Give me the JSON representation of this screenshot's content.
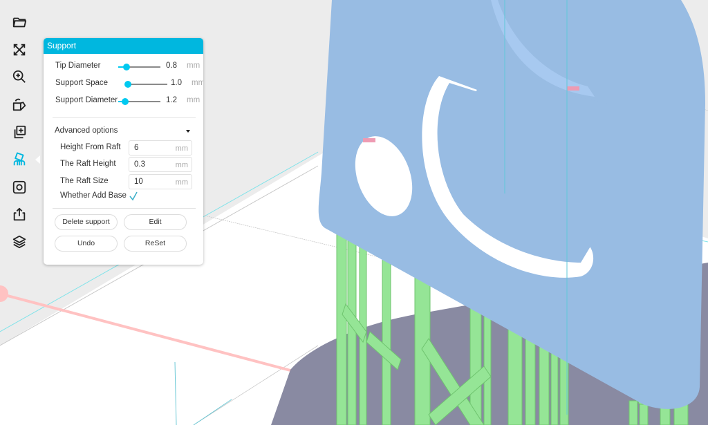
{
  "toolbar": {
    "items": [
      {
        "icon": "folder-open-icon",
        "label": "Open"
      },
      {
        "icon": "expand-arrows-icon",
        "label": "Scale"
      },
      {
        "icon": "zoom-in-icon",
        "label": "Zoom"
      },
      {
        "icon": "rotate-icon",
        "label": "Rotate"
      },
      {
        "icon": "add-copy-icon",
        "label": "Duplicate"
      },
      {
        "icon": "support-icon",
        "label": "Support",
        "active": true
      },
      {
        "icon": "hollow-icon",
        "label": "Hollow"
      },
      {
        "icon": "export-icon",
        "label": "Export"
      },
      {
        "icon": "layers-icon",
        "label": "Layers"
      }
    ],
    "active_color": "#00b7df"
  },
  "support_panel": {
    "title": "Support",
    "sliders": [
      {
        "label": "Tip Diameter",
        "value": "0.8",
        "unit": "mm",
        "fraction": 0.08
      },
      {
        "label": "Support Space",
        "value": "1.0",
        "unit": "mm",
        "fraction": 0.0
      },
      {
        "label": "Support Diameter",
        "value": "1.2",
        "unit": "mm",
        "fraction": 0.07
      }
    ],
    "advanced": {
      "label": "Advanced options",
      "fields": [
        {
          "label": "Height From Raft",
          "value": "6",
          "unit": "mm"
        },
        {
          "label": "The Raft Height",
          "value": "0.3",
          "unit": "mm"
        },
        {
          "label": "The Raft Size",
          "value": "10",
          "unit": "mm"
        }
      ],
      "add_base": {
        "label": "Whether Add Base",
        "checked": true
      }
    },
    "buttons": {
      "delete_support": "Delete support",
      "edit": "Edit",
      "undo": "Undo",
      "reset": "ReSet"
    }
  },
  "colors": {
    "accent": "#00b7df",
    "model": "#98bce3",
    "support": "#95e596",
    "platform": "#898aa2",
    "background_plane": "#ececec"
  }
}
